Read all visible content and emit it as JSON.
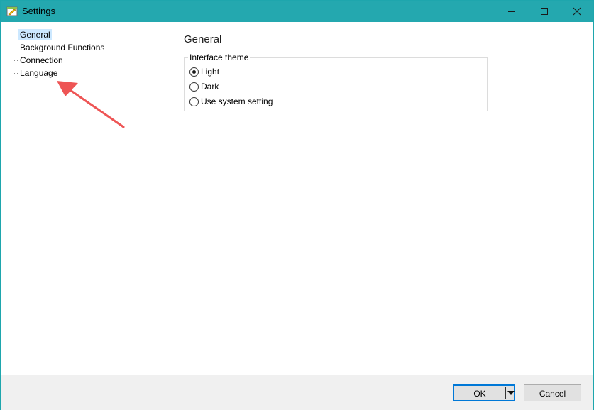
{
  "window": {
    "title": "Settings",
    "controls": {
      "minimize": "minimize-icon",
      "maximize": "maximize-icon",
      "close": "close-icon"
    }
  },
  "tree": {
    "items": [
      {
        "label": "General",
        "selected": true
      },
      {
        "label": "Background Functions",
        "selected": false
      },
      {
        "label": "Connection",
        "selected": false
      },
      {
        "label": "Language",
        "selected": false
      }
    ]
  },
  "content": {
    "title": "General",
    "theme_group": {
      "legend": "Interface theme",
      "options": [
        {
          "label": "Light",
          "checked": true
        },
        {
          "label": "Dark",
          "checked": false
        },
        {
          "label": "Use system setting",
          "checked": false
        }
      ]
    }
  },
  "footer": {
    "ok_label": "OK",
    "cancel_label": "Cancel"
  },
  "colors": {
    "titlebar": "#24a8af",
    "selection": "#cce8ff",
    "annotation": "#ee5555",
    "focus": "#0078d7"
  }
}
